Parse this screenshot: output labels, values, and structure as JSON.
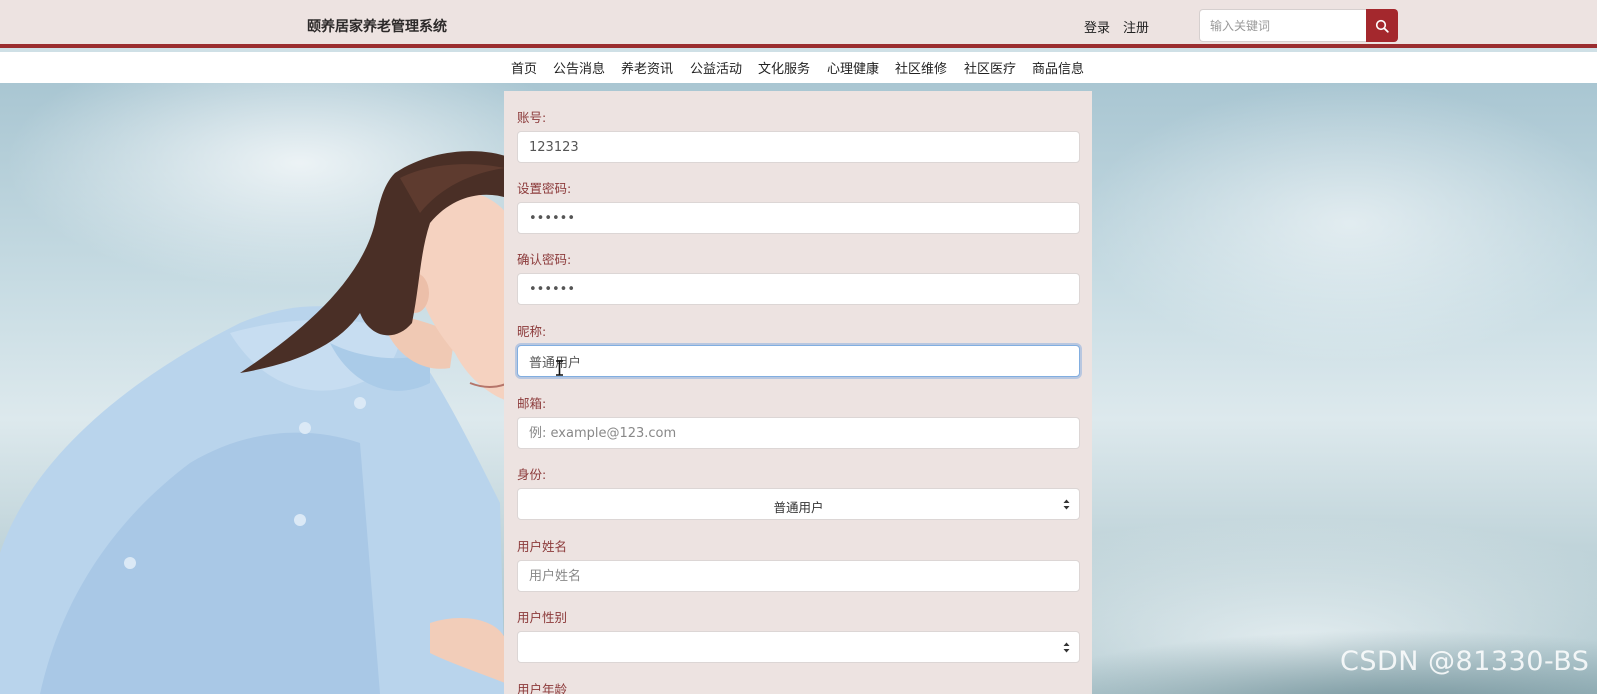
{
  "header": {
    "site_title": "颐养居家养老管理系统",
    "login_label": "登录",
    "register_label": "注册",
    "search_placeholder": "输入关键词",
    "search_icon": "search-icon",
    "accent_color": "#9b2d2f"
  },
  "nav": {
    "items": [
      {
        "label": "首页"
      },
      {
        "label": "公告消息"
      },
      {
        "label": "养老资讯"
      },
      {
        "label": "公益活动"
      },
      {
        "label": "文化服务"
      },
      {
        "label": "心理健康"
      },
      {
        "label": "社区维修"
      },
      {
        "label": "社区医疗"
      },
      {
        "label": "商品信息"
      }
    ]
  },
  "form": {
    "account": {
      "label": "账号:",
      "value": "123123"
    },
    "password": {
      "label": "设置密码:",
      "value": "123123"
    },
    "confirm_password": {
      "label": "确认密码:",
      "value": "123123"
    },
    "nickname": {
      "label": "昵称:",
      "value": "普通用户"
    },
    "email": {
      "label": "邮箱:",
      "placeholder": "例: example@123.com",
      "value": ""
    },
    "identity": {
      "label": "身份:",
      "selected": "普通用户"
    },
    "real_name": {
      "label": "用户姓名",
      "placeholder": "用户姓名",
      "value": ""
    },
    "gender": {
      "label": "用户性别",
      "selected": ""
    },
    "age": {
      "label": "用户年龄"
    }
  },
  "watermark": "CSDN @81330-BS"
}
